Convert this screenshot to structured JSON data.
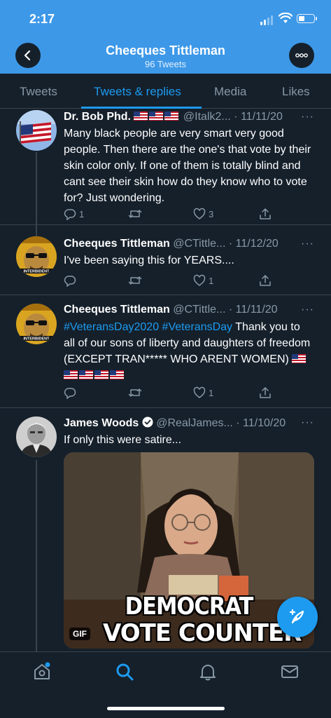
{
  "status_bar": {
    "time": "2:17"
  },
  "header": {
    "title": "Cheeques Tittleman",
    "subtitle": "96 Tweets"
  },
  "tabs": [
    {
      "label": "Tweets"
    },
    {
      "label": "Tweets & replies"
    },
    {
      "label": "Media"
    },
    {
      "label": "Likes"
    }
  ],
  "tweets": [
    {
      "name": "Dr. Bob Phd.",
      "handle": "@Italk2...",
      "date": "· 11/11/20",
      "text": "Many black people are very smart very good people. Then there are the one's that vote by their skin color only.  If one of them is totally blind and cant see their skin how do they know who to vote for? Just wondering.",
      "replies": "1",
      "retweets": "",
      "likes": "3"
    },
    {
      "name": "Cheeques Tittleman",
      "handle": "@CTittle...",
      "date": "· 11/12/20",
      "text": "I've been saying this for YEARS....",
      "replies": "",
      "retweets": "",
      "likes": "1",
      "avatar_text": "INTERBIDENT"
    },
    {
      "name": "Cheeques Tittleman",
      "handle": "@CTittle...",
      "date": "· 11/11/20",
      "hashtags": "#VeteransDay2020 #VeteransDay",
      "text": " Thank you to all of our sons of liberty and daughters of freedom (EXCEPT TRAN***** WHO ARENT WOMEN)",
      "replies": "",
      "retweets": "",
      "likes": "1",
      "avatar_text": "INTERBIDENT"
    },
    {
      "name": "James Woods",
      "handle": "@RealJames...",
      "date": "· 11/10/20",
      "text": "If only this were satire...",
      "gif": {
        "caption_line1": "DEMOCRAT",
        "caption_line2": "VOTE COUNTER",
        "badge": "GIF"
      }
    }
  ],
  "more_glyph": "···",
  "colors": {
    "accent": "#1d9bf0",
    "background": "#15202b",
    "header": "#3d98e8",
    "muted": "#8899a6"
  }
}
